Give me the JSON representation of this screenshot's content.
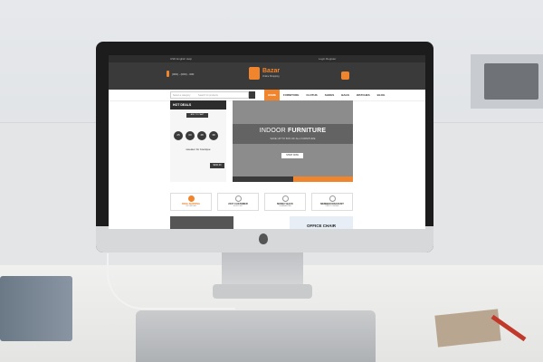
{
  "site": {
    "logo": "Bazar",
    "logo_tag": "Online Shopping",
    "topbar": "USD  English  Help",
    "phone": "(000) - (000) - 000",
    "account": "Login  Register"
  },
  "nav": {
    "search_placeholder": "Search for products",
    "category": "Select a category",
    "items": [
      "HOME",
      "FURNITURE",
      "CLOTHS",
      "SHOES",
      "BAGS",
      "WATCHES",
      "BLOG"
    ]
  },
  "hot_deals": {
    "title": "HOT DEALS",
    "button": "ADD TO CART",
    "countdown": [
      "25",
      "00",
      "48",
      "38"
    ],
    "countdown_labels": [
      "DAYS",
      "HRS",
      "MIN",
      "SEC"
    ],
    "product": "sweater for boutique",
    "price": "$100.00"
  },
  "banner": {
    "title_light": "INDOOR ",
    "title_bold": "FURNITURE",
    "subtitle": "SAVE UP TO 50% OF ALL FURNITURE",
    "button": "SHOP NOW"
  },
  "features": [
    {
      "title": "FREE SHIPPING",
      "sub": "ON ORDER",
      "icon": "truck-icon",
      "accent": "#f0852d"
    },
    {
      "title": "24X7 CUSTOMER",
      "sub": "SUPPORT",
      "icon": "headset-icon",
      "accent": "#333333"
    },
    {
      "title": "MONEY BACK",
      "sub": "GUARANTEE",
      "icon": "money-icon",
      "accent": "#333333"
    },
    {
      "title": "MEMBER DISCOUNT",
      "sub": "FIRST ORDER",
      "icon": "megaphone-icon",
      "accent": "#333333"
    }
  ],
  "promo": {
    "office": "OFFICE CHAIR"
  },
  "colors": {
    "accent": "#f0852d",
    "dark": "#3a3a3a"
  }
}
